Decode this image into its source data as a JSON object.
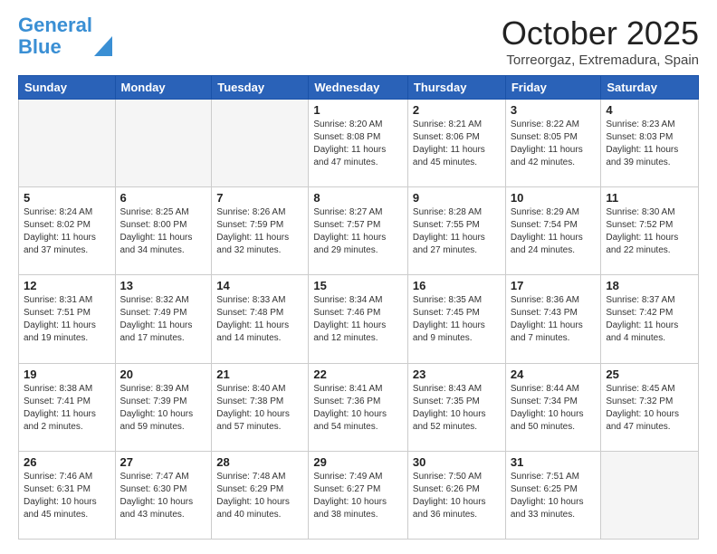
{
  "logo": {
    "line1": "General",
    "line2": "Blue"
  },
  "header": {
    "title": "October 2025",
    "location": "Torreorgaz, Extremadura, Spain"
  },
  "weekdays": [
    "Sunday",
    "Monday",
    "Tuesday",
    "Wednesday",
    "Thursday",
    "Friday",
    "Saturday"
  ],
  "weeks": [
    [
      {
        "day": "",
        "empty": true
      },
      {
        "day": "",
        "empty": true
      },
      {
        "day": "",
        "empty": true
      },
      {
        "day": "1",
        "sunrise": "8:20 AM",
        "sunset": "8:08 PM",
        "daylight": "11 hours and 47 minutes."
      },
      {
        "day": "2",
        "sunrise": "8:21 AM",
        "sunset": "8:06 PM",
        "daylight": "11 hours and 45 minutes."
      },
      {
        "day": "3",
        "sunrise": "8:22 AM",
        "sunset": "8:05 PM",
        "daylight": "11 hours and 42 minutes."
      },
      {
        "day": "4",
        "sunrise": "8:23 AM",
        "sunset": "8:03 PM",
        "daylight": "11 hours and 39 minutes."
      }
    ],
    [
      {
        "day": "5",
        "sunrise": "8:24 AM",
        "sunset": "8:02 PM",
        "daylight": "11 hours and 37 minutes."
      },
      {
        "day": "6",
        "sunrise": "8:25 AM",
        "sunset": "8:00 PM",
        "daylight": "11 hours and 34 minutes."
      },
      {
        "day": "7",
        "sunrise": "8:26 AM",
        "sunset": "7:59 PM",
        "daylight": "11 hours and 32 minutes."
      },
      {
        "day": "8",
        "sunrise": "8:27 AM",
        "sunset": "7:57 PM",
        "daylight": "11 hours and 29 minutes."
      },
      {
        "day": "9",
        "sunrise": "8:28 AM",
        "sunset": "7:55 PM",
        "daylight": "11 hours and 27 minutes."
      },
      {
        "day": "10",
        "sunrise": "8:29 AM",
        "sunset": "7:54 PM",
        "daylight": "11 hours and 24 minutes."
      },
      {
        "day": "11",
        "sunrise": "8:30 AM",
        "sunset": "7:52 PM",
        "daylight": "11 hours and 22 minutes."
      }
    ],
    [
      {
        "day": "12",
        "sunrise": "8:31 AM",
        "sunset": "7:51 PM",
        "daylight": "11 hours and 19 minutes."
      },
      {
        "day": "13",
        "sunrise": "8:32 AM",
        "sunset": "7:49 PM",
        "daylight": "11 hours and 17 minutes."
      },
      {
        "day": "14",
        "sunrise": "8:33 AM",
        "sunset": "7:48 PM",
        "daylight": "11 hours and 14 minutes."
      },
      {
        "day": "15",
        "sunrise": "8:34 AM",
        "sunset": "7:46 PM",
        "daylight": "11 hours and 12 minutes."
      },
      {
        "day": "16",
        "sunrise": "8:35 AM",
        "sunset": "7:45 PM",
        "daylight": "11 hours and 9 minutes."
      },
      {
        "day": "17",
        "sunrise": "8:36 AM",
        "sunset": "7:43 PM",
        "daylight": "11 hours and 7 minutes."
      },
      {
        "day": "18",
        "sunrise": "8:37 AM",
        "sunset": "7:42 PM",
        "daylight": "11 hours and 4 minutes."
      }
    ],
    [
      {
        "day": "19",
        "sunrise": "8:38 AM",
        "sunset": "7:41 PM",
        "daylight": "11 hours and 2 minutes."
      },
      {
        "day": "20",
        "sunrise": "8:39 AM",
        "sunset": "7:39 PM",
        "daylight": "10 hours and 59 minutes."
      },
      {
        "day": "21",
        "sunrise": "8:40 AM",
        "sunset": "7:38 PM",
        "daylight": "10 hours and 57 minutes."
      },
      {
        "day": "22",
        "sunrise": "8:41 AM",
        "sunset": "7:36 PM",
        "daylight": "10 hours and 54 minutes."
      },
      {
        "day": "23",
        "sunrise": "8:43 AM",
        "sunset": "7:35 PM",
        "daylight": "10 hours and 52 minutes."
      },
      {
        "day": "24",
        "sunrise": "8:44 AM",
        "sunset": "7:34 PM",
        "daylight": "10 hours and 50 minutes."
      },
      {
        "day": "25",
        "sunrise": "8:45 AM",
        "sunset": "7:32 PM",
        "daylight": "10 hours and 47 minutes."
      }
    ],
    [
      {
        "day": "26",
        "sunrise": "7:46 AM",
        "sunset": "6:31 PM",
        "daylight": "10 hours and 45 minutes."
      },
      {
        "day": "27",
        "sunrise": "7:47 AM",
        "sunset": "6:30 PM",
        "daylight": "10 hours and 43 minutes."
      },
      {
        "day": "28",
        "sunrise": "7:48 AM",
        "sunset": "6:29 PM",
        "daylight": "10 hours and 40 minutes."
      },
      {
        "day": "29",
        "sunrise": "7:49 AM",
        "sunset": "6:27 PM",
        "daylight": "10 hours and 38 minutes."
      },
      {
        "day": "30",
        "sunrise": "7:50 AM",
        "sunset": "6:26 PM",
        "daylight": "10 hours and 36 minutes."
      },
      {
        "day": "31",
        "sunrise": "7:51 AM",
        "sunset": "6:25 PM",
        "daylight": "10 hours and 33 minutes."
      },
      {
        "day": "",
        "empty": true
      }
    ]
  ],
  "labels": {
    "sunrise": "Sunrise:",
    "sunset": "Sunset:",
    "daylight": "Daylight:"
  }
}
